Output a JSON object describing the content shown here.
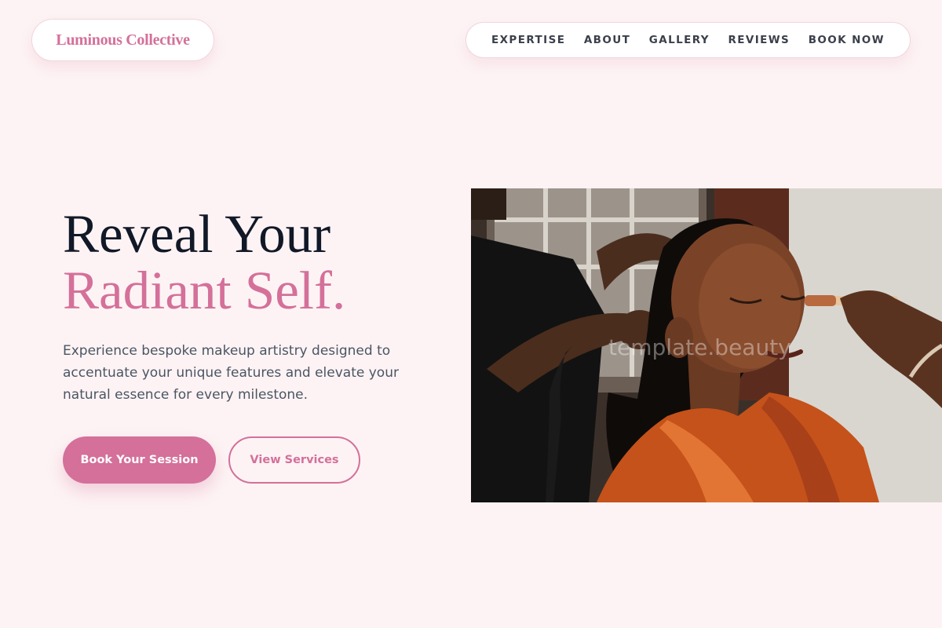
{
  "brand": {
    "name": "Luminous Collective"
  },
  "nav": {
    "items": [
      {
        "label": "EXPERTISE"
      },
      {
        "label": "ABOUT"
      },
      {
        "label": "GALLERY"
      },
      {
        "label": "REVIEWS"
      },
      {
        "label": "BOOK NOW"
      }
    ]
  },
  "hero": {
    "title_line1": "Reveal Your",
    "title_line2": "Radiant Self.",
    "description": "Experience bespoke makeup artistry designed to accentuate your unique features and elevate your natural essence for every milestone.",
    "primary_button": "Book Your Session",
    "secondary_button": "View Services",
    "image": {
      "watermark": "template.beauty"
    }
  },
  "colors": {
    "background": "#fdf3f4",
    "accent": "#d4709a",
    "heading": "#111827",
    "body_text": "#4b5563",
    "nav_text": "#3a3f4b"
  }
}
